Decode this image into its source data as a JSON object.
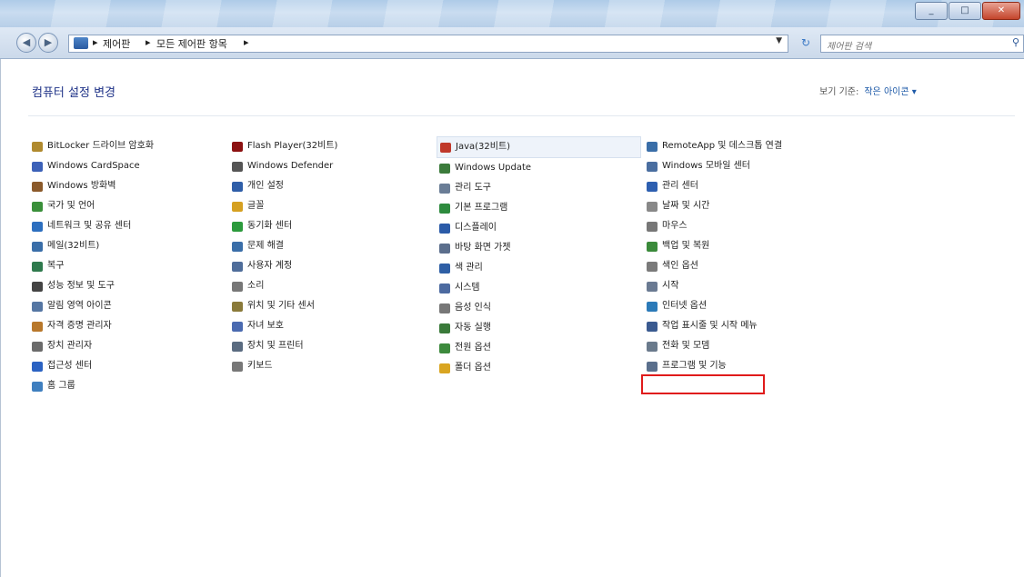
{
  "window": {
    "buttons": [
      "_",
      "□",
      "✕"
    ]
  },
  "address": {
    "breadcrumb": [
      "▸",
      "제어판",
      "▸",
      "모든 제어판 항목",
      "▸"
    ],
    "search_placeholder": "제어판 검색"
  },
  "header": {
    "title": "컴퓨터 설정 변경",
    "view_by_label": "보기 기준:",
    "view_by_value": "작은 아이콘 ▾"
  },
  "columns": [
    [
      {
        "label": "BitLocker 드라이브 암호화",
        "icon": "bitlocker-icon",
        "color": "#b08a2e"
      },
      {
        "label": "Windows CardSpace",
        "icon": "cardspace-icon",
        "color": "#3c61b8"
      },
      {
        "label": "Windows 방화벽",
        "icon": "firewall-icon",
        "color": "#8b5a2b"
      },
      {
        "label": "국가 및 언어",
        "icon": "region-icon",
        "color": "#3a8f3a"
      },
      {
        "label": "네트워크 및 공유 센터",
        "icon": "network-icon",
        "color": "#2d6fbf"
      },
      {
        "label": "메일(32비트)",
        "icon": "mail-icon",
        "color": "#3a6ea8"
      },
      {
        "label": "복구",
        "icon": "recovery-icon",
        "color": "#2f7a4d"
      },
      {
        "label": "성능 정보 및 도구",
        "icon": "performance-icon",
        "color": "#444444"
      },
      {
        "label": "알림 영역 아이콘",
        "icon": "notification-icon",
        "color": "#5576a3"
      },
      {
        "label": "자격 증명 관리자",
        "icon": "credential-icon",
        "color": "#b8782b"
      },
      {
        "label": "장치 관리자",
        "icon": "device-manager-icon",
        "color": "#6b6b6b"
      },
      {
        "label": "접근성 센터",
        "icon": "accessibility-icon",
        "color": "#2b62c2"
      },
      {
        "label": "홈 그룹",
        "icon": "homegroup-icon",
        "color": "#3f7fbf"
      }
    ],
    [
      {
        "label": "Flash Player(32비트)",
        "icon": "flash-icon",
        "color": "#8c1111"
      },
      {
        "label": "Windows Defender",
        "icon": "defender-icon",
        "color": "#555555"
      },
      {
        "label": "개인 설정",
        "icon": "personalization-icon",
        "color": "#2f5ea8"
      },
      {
        "label": "글꼴",
        "icon": "fonts-icon",
        "color": "#d5a021"
      },
      {
        "label": "동기화 센터",
        "icon": "sync-icon",
        "color": "#2c9a3c"
      },
      {
        "label": "문제 해결",
        "icon": "troubleshoot-icon",
        "color": "#3a6ea8"
      },
      {
        "label": "사용자 계정",
        "icon": "user-accounts-icon",
        "color": "#4f6d9a"
      },
      {
        "label": "소리",
        "icon": "sound-icon",
        "color": "#777777"
      },
      {
        "label": "위치 및 기타 센서",
        "icon": "sensor-icon",
        "color": "#8a7a3a"
      },
      {
        "label": "자녀 보호",
        "icon": "parental-icon",
        "color": "#4a6ab0"
      },
      {
        "label": "장치 및 프린터",
        "icon": "printer-icon",
        "color": "#5a6b80"
      },
      {
        "label": "키보드",
        "icon": "keyboard-icon",
        "color": "#777777"
      }
    ],
    [
      {
        "label": "Java(32비트)",
        "icon": "java-icon",
        "color": "#c0392b"
      },
      {
        "label": "Windows Update",
        "icon": "windows-update-icon",
        "color": "#3b7b3b"
      },
      {
        "label": "관리 도구",
        "icon": "admin-tools-icon",
        "color": "#6a7d96"
      },
      {
        "label": "기본 프로그램",
        "icon": "default-programs-icon",
        "color": "#2e8b3e"
      },
      {
        "label": "디스플레이",
        "icon": "display-icon",
        "color": "#2b5ba8"
      },
      {
        "label": "바탕 화면 가젯",
        "icon": "gadgets-icon",
        "color": "#5b6e8c"
      },
      {
        "label": "색 관리",
        "icon": "color-icon",
        "color": "#2f5fa5"
      },
      {
        "label": "시스템",
        "icon": "system-icon",
        "color": "#4c6aa0"
      },
      {
        "label": "음성 인식",
        "icon": "speech-icon",
        "color": "#777777"
      },
      {
        "label": "자동 실행",
        "icon": "autoplay-icon",
        "color": "#3a7a3a"
      },
      {
        "label": "전원 옵션",
        "icon": "power-icon",
        "color": "#3d8a3d"
      },
      {
        "label": "폴더 옵션",
        "icon": "folder-icon",
        "color": "#d9a521"
      }
    ],
    [
      {
        "label": "RemoteApp 및 데스크톱 연결",
        "icon": "remoteapp-icon",
        "color": "#3a6ea8"
      },
      {
        "label": "Windows 모바일 센터",
        "icon": "mobility-icon",
        "color": "#4a6ea0"
      },
      {
        "label": "관리 센터",
        "icon": "action-center-icon",
        "color": "#2d5fb0"
      },
      {
        "label": "날짜 및 시간",
        "icon": "datetime-icon",
        "color": "#888888"
      },
      {
        "label": "마우스",
        "icon": "mouse-icon",
        "color": "#777777"
      },
      {
        "label": "백업 및 복원",
        "icon": "backup-icon",
        "color": "#3a8a3a"
      },
      {
        "label": "색인 옵션",
        "icon": "indexing-icon",
        "color": "#7a7a7a"
      },
      {
        "label": "시작",
        "icon": "getting-started-icon",
        "color": "#6a7a92"
      },
      {
        "label": "인터넷 옵션",
        "icon": "internet-options-icon",
        "color": "#2b7ab8"
      },
      {
        "label": "작업 표시줄 및 시작 메뉴",
        "icon": "taskbar-icon",
        "color": "#3a5a90"
      },
      {
        "label": "전화 및 모뎀",
        "icon": "phone-modem-icon",
        "color": "#6a7a8c"
      },
      {
        "label": "프로그램 및 기능",
        "icon": "programs-features-icon",
        "color": "#5a6f8c"
      }
    ]
  ]
}
